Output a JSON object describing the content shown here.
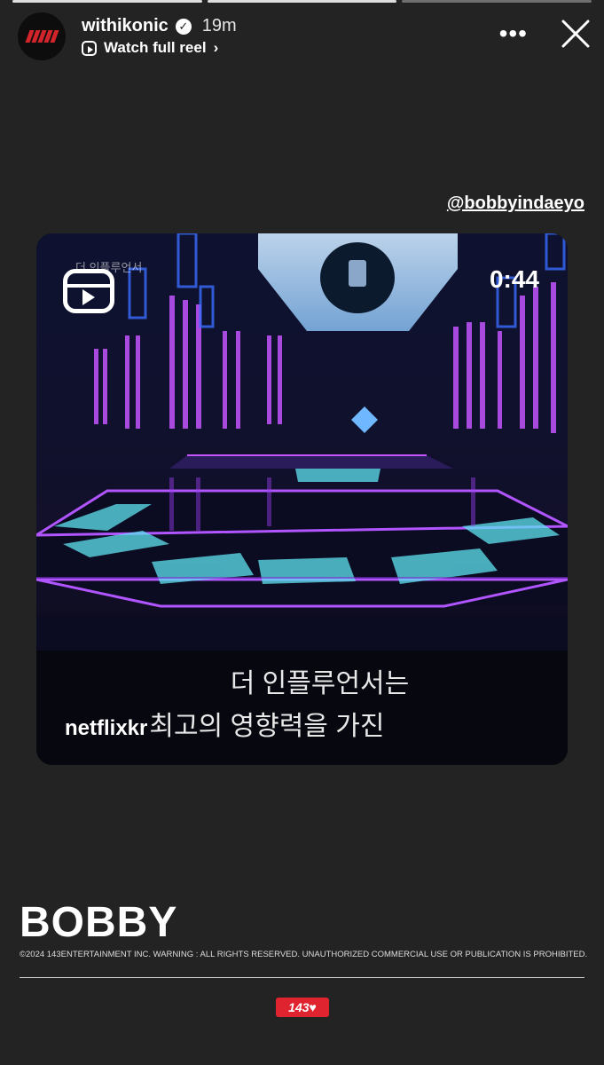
{
  "progress": {
    "segments": 3,
    "current": 2
  },
  "header": {
    "username": "withikonic",
    "verified": "✓",
    "time_ago": "19m",
    "watch_label": "Watch full reel",
    "watch_chevron": "›",
    "more_icon": "•••",
    "close_icon": "close-icon"
  },
  "mention": "@bobbyindaeyo",
  "reel": {
    "ghost_text": "더 인플루언서",
    "duration": "0:44",
    "caption_line1": "더 인플루언서는",
    "caption_owner": "netflixkr",
    "caption_line2": "최고의 영향력을 가진"
  },
  "footer": {
    "brand": "BOBBY",
    "copyright": "©2024 143ENTERTAINMENT INC. WARNING : ALL RIGHTS RESERVED. UNAUTHORIZED COMMERCIAL USE OR PUBLICATION IS PROHIBITED.",
    "label_logo": "143♥"
  },
  "colors": {
    "background": "#232323",
    "brand_red": "#d2252b",
    "neon_purple": "#c455ff",
    "neon_cyan": "#5fe3f0"
  }
}
